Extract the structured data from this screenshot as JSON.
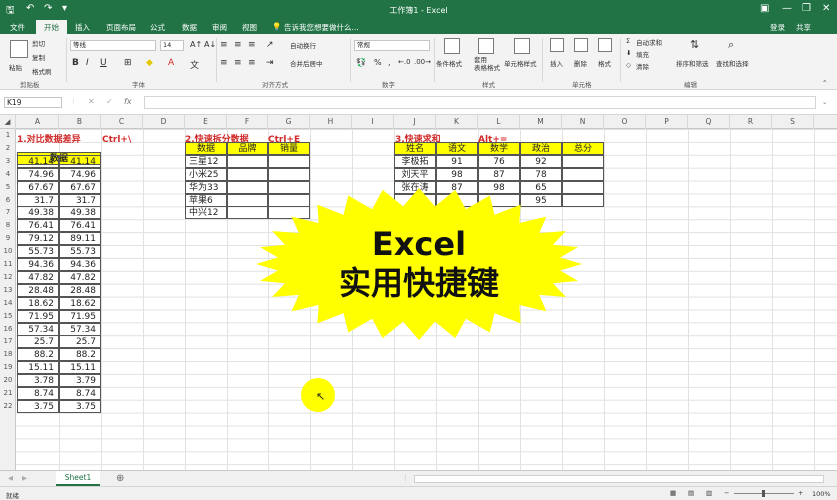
{
  "window": {
    "title": "工作簿1 - Excel",
    "share": "共享",
    "help_search": "告诉我您想要做什么..."
  },
  "tabs": [
    "文件",
    "开始",
    "插入",
    "页面布局",
    "公式",
    "数据",
    "审阅",
    "视图"
  ],
  "ribbon": {
    "clipboard": {
      "group": "剪贴板",
      "paste": "粘贴",
      "cut": "剪切",
      "copy": "复制",
      "format_painter": "格式刷"
    },
    "font": {
      "group": "字体",
      "name": "等线",
      "size": "14"
    },
    "alignment": {
      "group": "对齐方式",
      "wrap": "自动换行",
      "merge": "合并后居中"
    },
    "number": {
      "group": "数字",
      "format": "常规"
    },
    "styles": {
      "group": "样式",
      "conditional": "条件格式",
      "table": "套用\n表格格式",
      "cell_styles": "单元格样式"
    },
    "cells": {
      "group": "单元格",
      "insert": "插入",
      "delete": "删除",
      "format": "格式"
    },
    "editing": {
      "group": "编辑",
      "autosum": "自动求和",
      "fill": "填充",
      "clear": "清除",
      "sort": "排序和筛选",
      "find": "查找和选择"
    }
  },
  "formula_bar": {
    "name_box": "K19",
    "formula": ""
  },
  "columns": [
    "A",
    "B",
    "C",
    "D",
    "E",
    "F",
    "G",
    "H",
    "I",
    "J",
    "K",
    "L",
    "M",
    "N",
    "O",
    "P",
    "Q",
    "R",
    "S"
  ],
  "rows": [
    "1",
    "2",
    "3",
    "4",
    "5",
    "6",
    "7",
    "8",
    "9",
    "10",
    "11",
    "12",
    "13",
    "14",
    "15",
    "16",
    "17",
    "18",
    "19",
    "20",
    "21",
    "22"
  ],
  "section1": {
    "title": "1.对比数据差异",
    "shortcut": "Ctrl+\\",
    "header": "数据",
    "a": [
      "41.14",
      "74.96",
      "67.67",
      "31.7",
      "49.38",
      "76.41",
      "79.12",
      "55.73",
      "94.36",
      "47.82",
      "28.48",
      "18.62",
      "71.95",
      "57.34",
      "25.7",
      "88.2",
      "15.11",
      "3.78",
      "8.74",
      "3.75"
    ],
    "b": [
      "41.14",
      "74.96",
      "67.67",
      "31.7",
      "49.38",
      "76.41",
      "89.11",
      "55.73",
      "94.36",
      "47.82",
      "28.48",
      "18.62",
      "71.95",
      "57.34",
      "25.7",
      "88.2",
      "15.11",
      "3.79",
      "8.74",
      "3.75"
    ]
  },
  "section2": {
    "title": "2.快速拆分数据",
    "shortcut": "Ctrl+E",
    "headers": [
      "数据",
      "品牌",
      "销量"
    ],
    "data": [
      "三星12",
      "小米25",
      "华为33",
      "苹果6",
      "中兴12"
    ]
  },
  "section3": {
    "title": "3.快速求和",
    "shortcut": "Alt+=",
    "headers": [
      "姓名",
      "语文",
      "数学",
      "政治",
      "总分"
    ],
    "rows": [
      [
        "李极拓",
        "91",
        "76",
        "92"
      ],
      [
        "刘天平",
        "98",
        "87",
        "78"
      ],
      [
        "张在涛",
        "87",
        "98",
        "65"
      ],
      [
        "",
        "",
        "",
        "95"
      ]
    ]
  },
  "overlay": {
    "line1": "Excel",
    "line2": "实用快捷键"
  },
  "sheet_tabs": [
    "Sheet1"
  ],
  "status": {
    "left": "就绪",
    "zoom": "100%"
  }
}
